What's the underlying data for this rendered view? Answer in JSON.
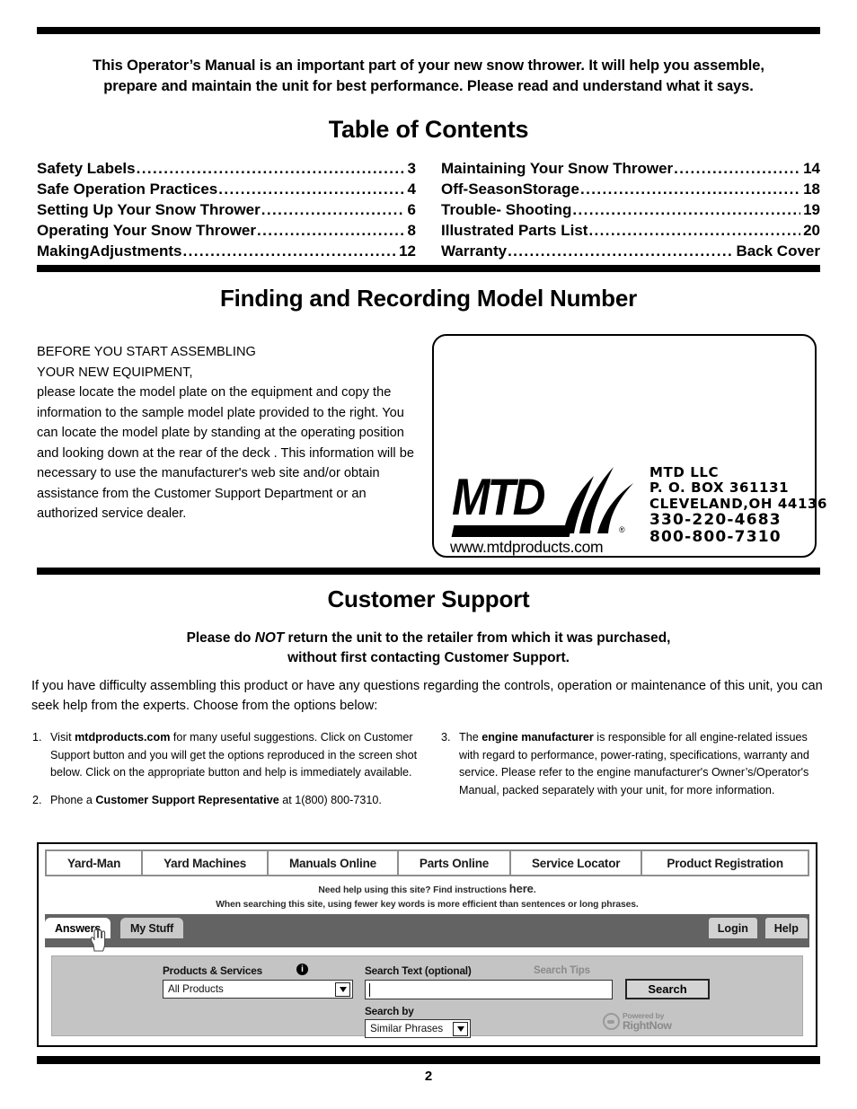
{
  "intro": {
    "line1": "This Operator’s Manual is an important part of your new snow thrower. It will help you assemble,",
    "line2": "prepare and maintain the unit for best performance. Please read and understand what it says."
  },
  "headings": {
    "toc": "Table of Contents",
    "model_number": "Finding and Recording Model Number",
    "customer_support": "Customer Support"
  },
  "toc": {
    "left": [
      {
        "title": "Safety Labels",
        "page": "3"
      },
      {
        "title": "Safe Operation Practices",
        "page": "4"
      },
      {
        "title": "Setting Up Your Snow Thrower",
        "page": "6"
      },
      {
        "title": "Operating Your Snow Thrower",
        "page": "8"
      },
      {
        "title": "MakingAdjustments",
        "page": "12"
      }
    ],
    "right": [
      {
        "title": "Maintaining Your Snow Thrower",
        "page": "14"
      },
      {
        "title": "Off-SeasonStorage",
        "page": "18"
      },
      {
        "title": "Trouble- Shooting",
        "page": "19"
      },
      {
        "title": "Illustrated Parts List",
        "page": "20"
      },
      {
        "title": "Warranty",
        "page": "Back Cover"
      }
    ],
    "dot_leader": "................................................................................................"
  },
  "model_section": {
    "lead_line1": "BEFORE YOU START ASSEMBLING",
    "lead_line2": "YOUR NEW EQUIPMENT,",
    "body": "please locate the model plate on the equipment and copy the information to the sample model plate provided to the right. You can locate the model plate by standing at the operating position and looking down at the rear of the deck . This information will be necessary to use the manufacturer's web site and/or obtain assistance from the Customer Support Department or an authorized service dealer."
  },
  "model_plate": {
    "logo_word": "MTD",
    "registered_mark": "®",
    "url": "www.mtdproducts.com",
    "address": {
      "company": "MTD  LLC",
      "pobox": "P. O. BOX  361131",
      "city": "CLEVELAND,OH 44136",
      "phone1": "330-220-4683",
      "phone2": "800-800-7310"
    }
  },
  "customer_support": {
    "sub_line1_a": "Please do ",
    "sub_line1_not": "NOT",
    "sub_line1_b": " return the unit to the retailer from which it was purchased,",
    "sub_line2": "without first contacting Customer Support.",
    "paragraph": "If you have difficulty assembling this product or have any questions regarding the controls, operation or maintenance of this unit, you can seek help from the experts. Choose from the options below:",
    "options": [
      {
        "number": "1.",
        "pre": "Visit ",
        "bold": "mtdproducts.com",
        "post": " for many useful suggestions. Click on Customer Support button and you will get the options reproduced in the screen shot below. Click on the appropriate button and help is immediately available."
      },
      {
        "number": "2.",
        "pre": "Phone a ",
        "bold": "Customer Support Representative",
        "post": " at 1(800) 800-7310."
      },
      {
        "number": "3.",
        "pre": "The ",
        "bold": "engine manufacturer",
        "post": " is responsible for all engine-related issues with regard to performance, power-rating, specifications, warranty and service. Please refer to the engine manufacturer's Owner’s/Operator's Manual, packed separately with your unit, for more information."
      }
    ]
  },
  "screenshot": {
    "tabs": [
      "Yard-Man",
      "Yard Machines",
      "Manuals Online",
      "Parts Online",
      "Service Locator",
      "Product Registration"
    ],
    "help_line1_a": "Need help using this site? Find instructions ",
    "help_line1_here": "here",
    "help_line1_b": ".",
    "help_line2": "When searching this site, using fewer key words is more efficient than sentences or long phrases.",
    "nav_tabs": [
      {
        "label": "Answers",
        "active": true
      },
      {
        "label": "My Stuff",
        "active": false
      }
    ],
    "nav_buttons": [
      {
        "label": "Login"
      },
      {
        "label": "Help"
      }
    ],
    "form": {
      "products_label": "Products & Services",
      "products_info_icon": "i",
      "products_value": "All Products",
      "search_text_label": "Search Text (optional)",
      "search_tips_label": "Search Tips",
      "search_text_value": "",
      "search_by_label": "Search by",
      "search_by_value": "Similar Phrases",
      "search_button": "Search",
      "powered_by_small": "Powered by",
      "powered_by_big": "RightNow"
    }
  },
  "page_number": "2",
  "colors": {
    "rule": "#000000",
    "shot_bar": "#636363",
    "form_bg": "#c4c4c4",
    "tab_inactive": "#c9c9c9",
    "tab_active": "#ffffff",
    "muted_text": "#8a8a8a"
  }
}
